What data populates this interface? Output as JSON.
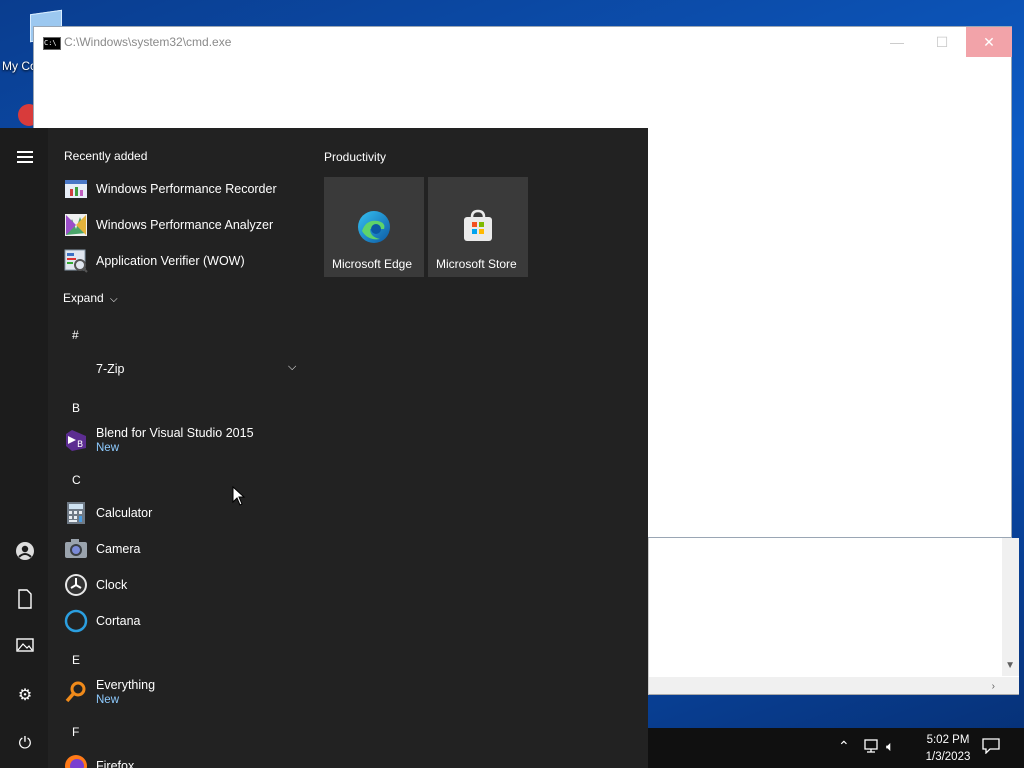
{
  "desktop": {
    "icon_label": "My Co"
  },
  "cmd_window": {
    "title": "C:\\Windows\\system32\\cmd.exe",
    "icon_text": "C:\\",
    "minimize": "—",
    "maximize": "☐",
    "close": "✕"
  },
  "start_menu": {
    "recently_added_header": "Recently added",
    "recent_items": [
      {
        "label": "Windows Performance Recorder",
        "icon": "performance-recorder-icon"
      },
      {
        "label": "Windows Performance Analyzer",
        "icon": "performance-analyzer-icon"
      },
      {
        "label": "Application Verifier (WOW)",
        "icon": "application-verifier-icon"
      }
    ],
    "expand_label": "Expand",
    "sections": [
      {
        "letter": "#",
        "items": [
          {
            "label": "7-Zip",
            "icon": "folder-icon",
            "expandable": true
          }
        ]
      },
      {
        "letter": "B",
        "items": [
          {
            "label": "Blend for Visual Studio 2015",
            "badge": "New",
            "icon": "blend-icon"
          }
        ]
      },
      {
        "letter": "C",
        "items": [
          {
            "label": "Calculator",
            "icon": "calculator-icon"
          },
          {
            "label": "Camera",
            "icon": "camera-icon"
          },
          {
            "label": "Clock",
            "icon": "clock-icon"
          },
          {
            "label": "Cortana",
            "icon": "cortana-icon"
          }
        ]
      },
      {
        "letter": "E",
        "items": [
          {
            "label": "Everything",
            "badge": "New",
            "icon": "everything-search-icon"
          }
        ]
      },
      {
        "letter": "F",
        "items": [
          {
            "label": "Firefox",
            "icon": "firefox-icon"
          }
        ]
      }
    ],
    "tile_group": "Productivity",
    "tiles": [
      {
        "label": "Microsoft Edge",
        "icon": "edge-icon"
      },
      {
        "label": "Microsoft Store",
        "icon": "store-icon"
      }
    ],
    "rail_icons": [
      "hamburger-menu-icon",
      "user-icon",
      "documents-icon",
      "pictures-icon",
      "settings-icon",
      "power-icon"
    ]
  },
  "taskbar": {
    "time": "5:02 PM",
    "date": "1/3/2023",
    "tray_icons": [
      "chevron-up-icon",
      "network-icon",
      "volume-icon",
      "notifications-icon"
    ]
  },
  "colors": {
    "start_bg": "#222222",
    "rail_bg": "#1c1c1c",
    "tile_bg": "#3a3a3a",
    "new_badge": "#8ecbff",
    "close_hover": "#f2a3a9"
  }
}
